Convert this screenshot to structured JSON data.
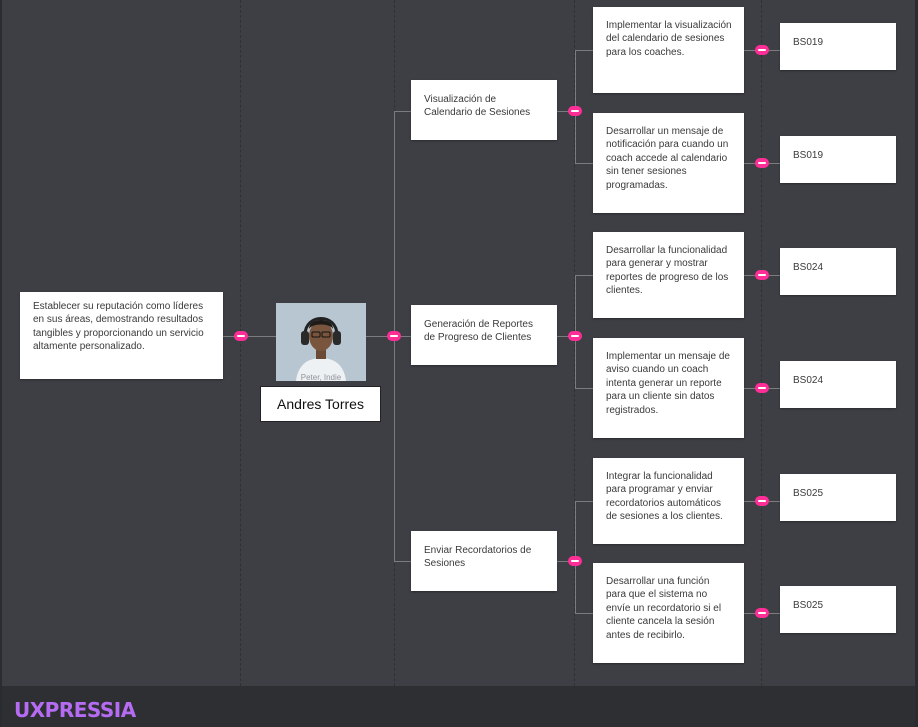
{
  "root": {
    "text": "Establecer su reputación como líderes en sus áreas, demostrando resultados tangibles y proporcionando un servicio altamente personalizado."
  },
  "persona": {
    "name": "Andres Torres",
    "photo_caption": "Peter, Indie"
  },
  "features": [
    {
      "title": "Visualización de Calendario de Sesiones",
      "tasks": [
        {
          "text": "Implementar la visualización del calendario de sesiones para los coaches.",
          "code": "BS019"
        },
        {
          "text": "Desarrollar un mensaje de notificación para cuando un coach accede al calendario sin tener sesiones programadas.",
          "code": "BS019"
        }
      ]
    },
    {
      "title": "Generación de Reportes de Progreso de Clientes",
      "tasks": [
        {
          "text": "Desarrollar la funcionalidad para generar y mostrar reportes de progreso de los clientes.",
          "code": "BS024"
        },
        {
          "text": "Implementar un mensaje de aviso cuando un coach intenta generar un reporte para un cliente sin datos registrados.",
          "code": "BS024"
        }
      ]
    },
    {
      "title": "Enviar Recordatorios de Sesiones",
      "tasks": [
        {
          "text": "Integrar la funcionalidad para programar y enviar recordatorios automáticos de sesiones a los clientes.",
          "code": "BS025"
        },
        {
          "text": "Desarrollar una función para que el sistema no envíe un recordatorio si el cliente cancela la sesión antes de recibirlo.",
          "code": "BS025"
        }
      ]
    }
  ],
  "footer": {
    "brand": "UXPRESSIA"
  },
  "colors": {
    "connector_pill": "#ff2d96",
    "canvas": "#3d3f45",
    "brand": "#b66cf2"
  }
}
